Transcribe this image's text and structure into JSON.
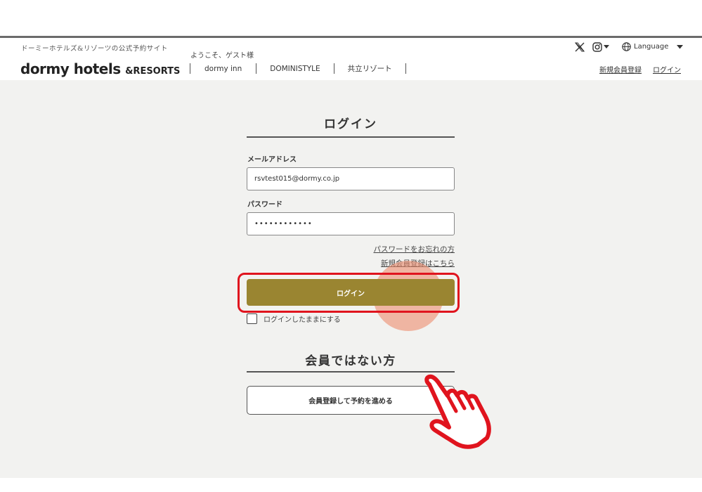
{
  "header": {
    "tagline": "ドーミーホテルズ&リゾーツの公式予約サイト",
    "welcome": "ようこそ、ゲスト様",
    "logo_main": "dormy hotels",
    "logo_sub": "&RESORTS",
    "nav": [
      "dormy inn",
      "DOMINISTYLE",
      "共立リゾート"
    ],
    "language_label": "Language",
    "register_link": "新規会員登録",
    "login_link": "ログイン",
    "icons": [
      "x-logo-icon",
      "instagram-icon",
      "globe-icon"
    ]
  },
  "login": {
    "title": "ログイン",
    "email_label": "メールアドレス",
    "email_value": "rsvtest015@dormy.co.jp",
    "password_label": "パスワード",
    "password_value": "••••••••••••",
    "forgot_link": "パスワードをお忘れの方",
    "register_link": "新規会員登録はこちら",
    "submit_label": "ログイン",
    "remember_label": "ログインしたままにする",
    "remember_checked": false
  },
  "nonmember": {
    "title": "会員ではない方",
    "signup_button": "会員登録して予約を進める"
  },
  "colors": {
    "accent_gold": "#9a8531",
    "highlight_red": "#e0141e",
    "background": "#f2f2f0"
  }
}
